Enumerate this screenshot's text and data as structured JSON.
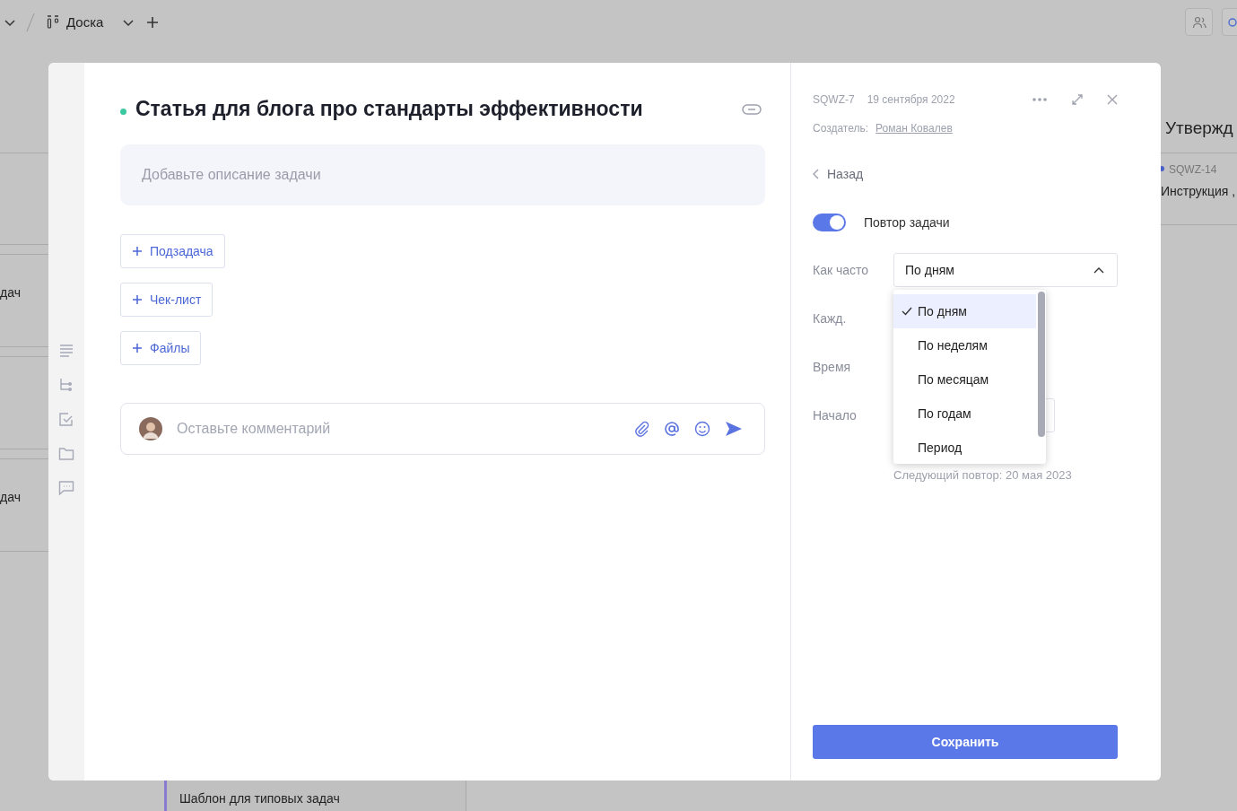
{
  "background": {
    "breadcrumb": "Доска",
    "left_texts": [
      "дач",
      "дач"
    ],
    "column_title": "Утвержд",
    "card_id": "SQWZ-14",
    "card_title": "Инструкция ,",
    "bottom_card": "Шаблон для типовых задач"
  },
  "task": {
    "title": "Статья для блога про стандарты эффективности",
    "description_placeholder": "Добавьте описание задачи",
    "add_buttons": [
      "Подзадача",
      "Чек-лист",
      "Файлы"
    ],
    "comment_placeholder": "Оставьте комментарий"
  },
  "panel": {
    "id": "SQWZ-7",
    "date": "19 сентября 2022",
    "creator_label": "Создатель:",
    "creator": "Роман Ковалев",
    "back": "Назад",
    "repeat": {
      "label": "Повтор задачи",
      "on": true
    },
    "fields": [
      {
        "kind": "select",
        "label": "Как часто",
        "value": "По дням",
        "expanded": true
      },
      {
        "kind": "plain",
        "label": "Кажд."
      },
      {
        "kind": "plain",
        "label": "Время"
      },
      {
        "kind": "input",
        "label": "Начало"
      }
    ],
    "options": [
      {
        "label": "По дням",
        "selected": true
      },
      {
        "label": "По неделям",
        "selected": false
      },
      {
        "label": "По месяцам",
        "selected": false
      },
      {
        "label": "По годам",
        "selected": false
      },
      {
        "label": "Период",
        "selected": false
      }
    ],
    "next_repeat": "Следующий повтор: 20 мая 2023",
    "save": "Сохранить"
  }
}
